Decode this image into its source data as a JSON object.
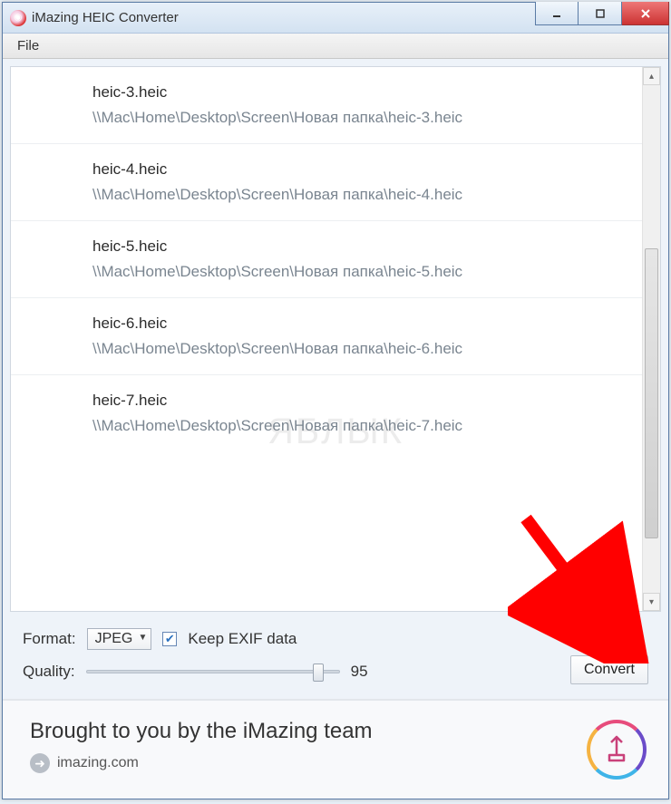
{
  "window": {
    "title": "iMazing HEIC Converter"
  },
  "menubar": {
    "file": "File"
  },
  "files": [
    {
      "name": "heic-3.heic",
      "path": "\\\\Mac\\Home\\Desktop\\Screen\\Новая папка\\heic-3.heic"
    },
    {
      "name": "heic-4.heic",
      "path": "\\\\Mac\\Home\\Desktop\\Screen\\Новая папка\\heic-4.heic"
    },
    {
      "name": "heic-5.heic",
      "path": "\\\\Mac\\Home\\Desktop\\Screen\\Новая папка\\heic-5.heic"
    },
    {
      "name": "heic-6.heic",
      "path": "\\\\Mac\\Home\\Desktop\\Screen\\Новая папка\\heic-6.heic"
    },
    {
      "name": "heic-7.heic",
      "path": "\\\\Mac\\Home\\Desktop\\Screen\\Новая папка\\heic-7.heic"
    }
  ],
  "settings": {
    "format_label": "Format:",
    "format_value": "JPEG",
    "keep_exif_label": "Keep EXIF data",
    "keep_exif_checked": true,
    "quality_label": "Quality:",
    "quality_value": "95",
    "convert_label": "Convert"
  },
  "footer": {
    "headline": "Brought to you by the iMazing team",
    "link_text": "imazing.com"
  },
  "watermark": "ЯБЛЫК"
}
